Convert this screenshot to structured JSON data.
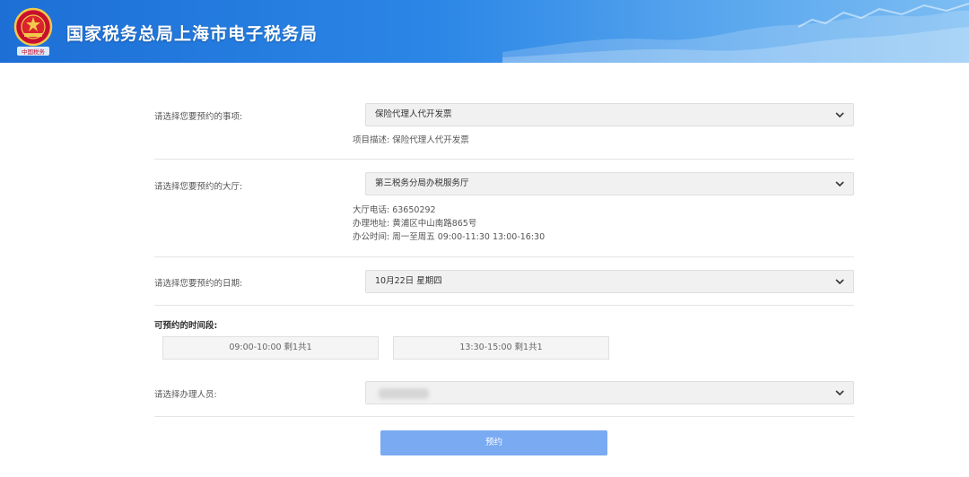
{
  "header": {
    "title": "国家税务总局上海市电子税务局",
    "emblem_icon": "tax-emblem-icon",
    "emblem_caption": "中国税务",
    "gradient_start": "#1d6fd6",
    "gradient_end": "#7cbdf3"
  },
  "form": {
    "matter": {
      "label": "请选择您要预约的事项:",
      "selected": "保险代理人代开发票",
      "description": "项目描述: 保险代理人代开发票"
    },
    "hall": {
      "label": "请选择您要预约的大厅:",
      "selected": "第三税务分局办税服务厅",
      "phone": "大厅电话: 63650292",
      "address": "办理地址: 黄浦区中山南路865号",
      "hours": "办公时间: 周一至周五 09:00-11:30 13:00-16:30"
    },
    "date": {
      "label": "请选择您要预约的日期:",
      "selected": "10月22日 星期四"
    },
    "slots": {
      "title": "可预约的时间段:",
      "items": [
        {
          "text": "09:00-10:00  剩1共1"
        },
        {
          "text": "13:30-15:00  剩1共1"
        }
      ]
    },
    "staff": {
      "label": "请选择办理人员:",
      "selected": ""
    },
    "submit_label": "预约",
    "submit_color": "#7aaaf2"
  },
  "icons": {
    "dropdown": "chevron-down-icon"
  }
}
